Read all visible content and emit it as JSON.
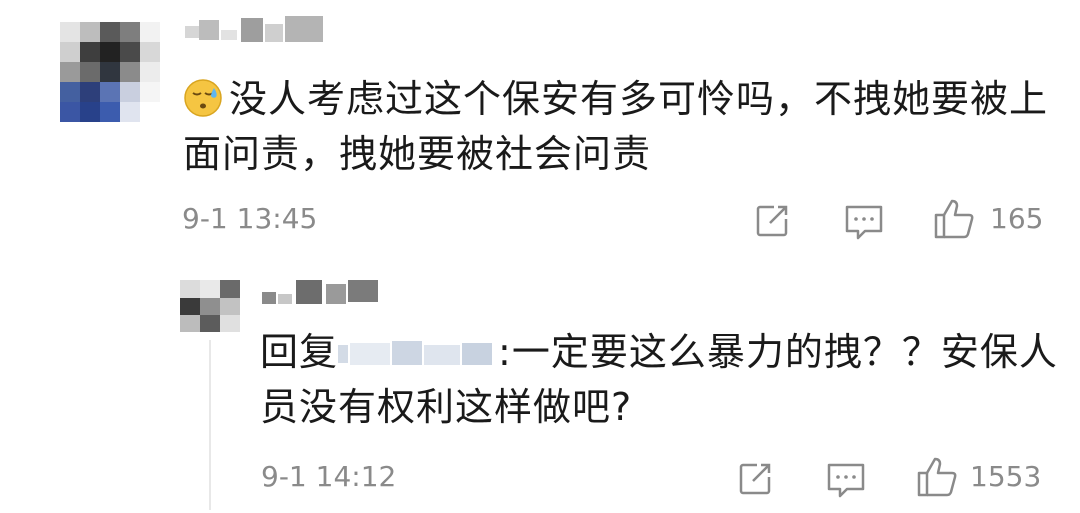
{
  "comment": {
    "emoji": "sweat-emoji",
    "text": "没人考虑过这个保安有多可怜吗，不拽她要被上面问责，拽她要被社会问责",
    "time": "9-1 13:45",
    "likes": "165"
  },
  "reply": {
    "prefix": "回复",
    "body": ":一定要这么暴力的拽？？安保人员没有权利这样做吧?",
    "time": "9-1 14:12",
    "likes": "1553"
  },
  "colors": {
    "text": "#1a1a1a",
    "meta": "#8a8a8a",
    "thread_line": "#e8e8e8"
  }
}
